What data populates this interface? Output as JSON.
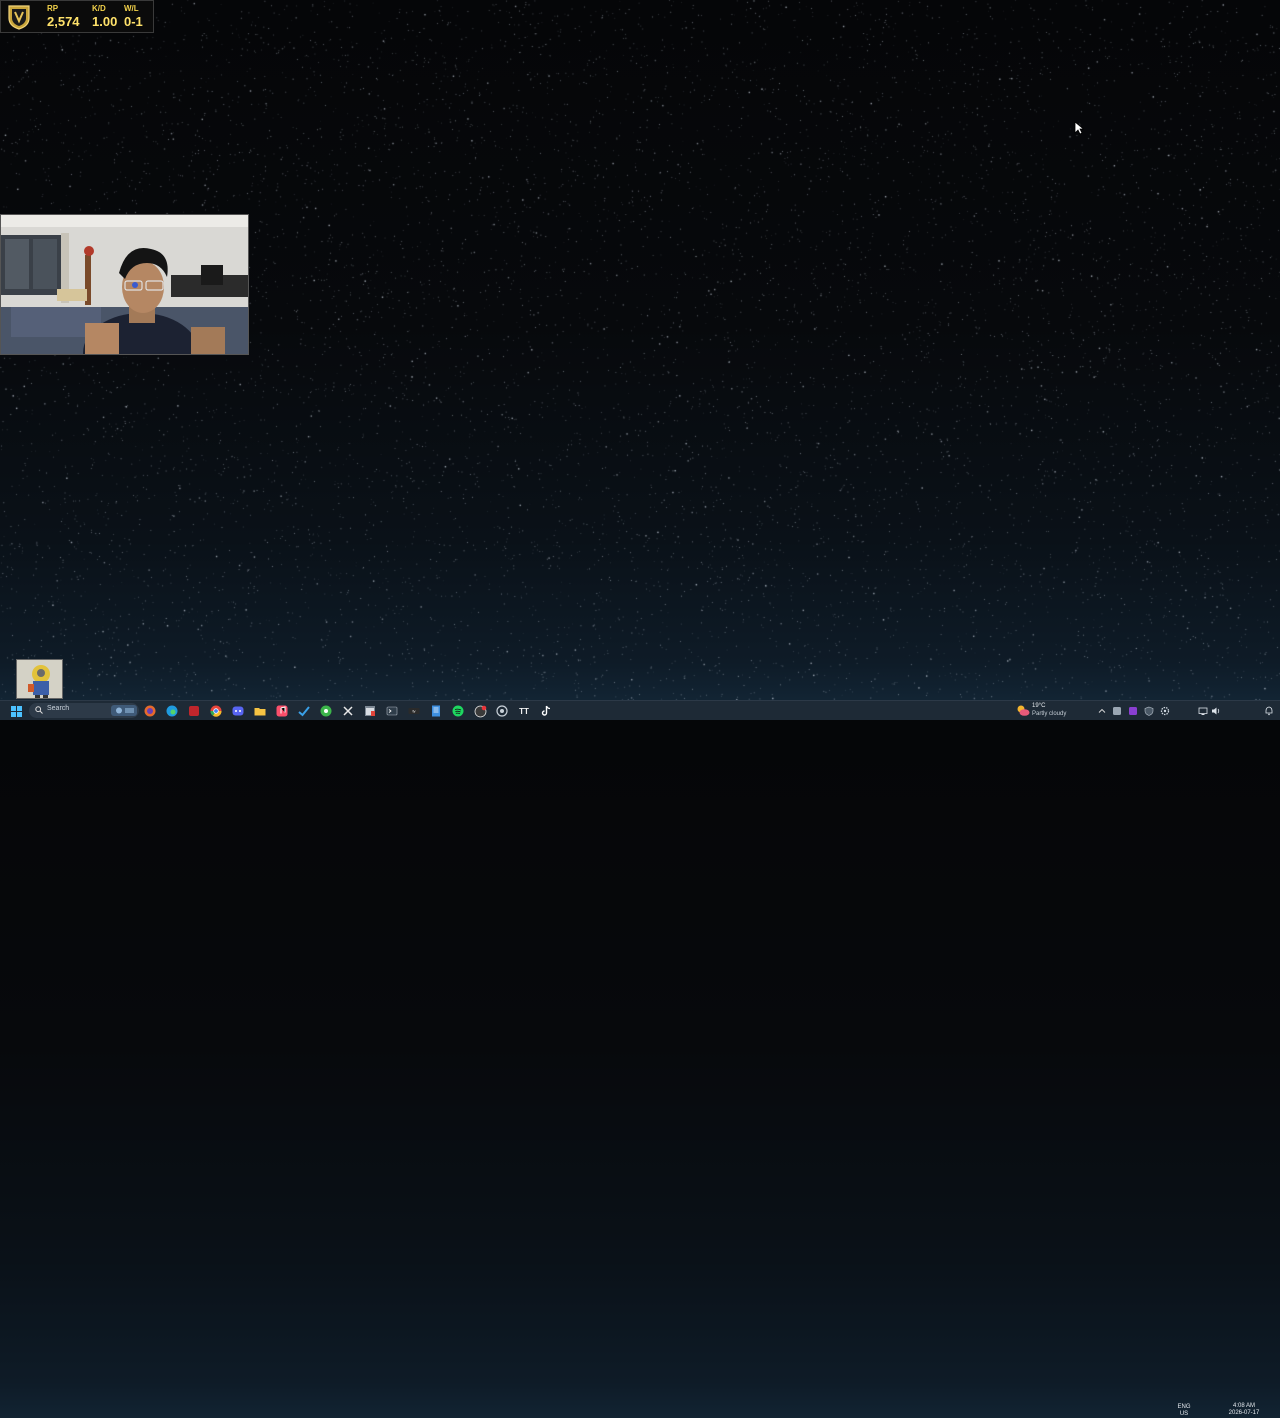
{
  "stats_overlay": {
    "rp_label": "RP",
    "rp_value": "2,574",
    "kd_label": "K/D",
    "kd_value": "1.00",
    "wl_label": "W/L",
    "wl_value": "0-1"
  },
  "taskbar": {
    "search_placeholder": "Search",
    "weather_temp": "19°C",
    "weather_condition": "Partly cloudy",
    "language_top": "ENG",
    "language_bottom": "US",
    "time": "4:08 AM",
    "date": "2026-07-17"
  },
  "colors": {
    "accent_gold": "#ffe26a",
    "taskbar_bg": "#1e2a36"
  }
}
